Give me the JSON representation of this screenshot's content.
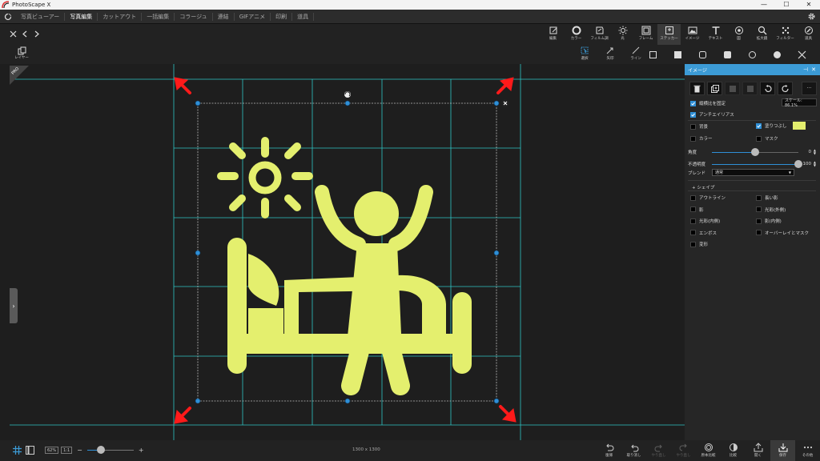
{
  "window": {
    "title": "PhotoScape X",
    "minimize": "—",
    "maximize": "☐",
    "close": "✕"
  },
  "menu": {
    "tabs": [
      "写真ビューアー",
      "写真編集",
      "カットアウト",
      "一括編集",
      "コラージュ",
      "連結",
      "GIFアニメ",
      "印刷",
      "道具"
    ],
    "active_index": 1
  },
  "toolbar": {
    "tools": [
      {
        "label": "編集",
        "icon": "edit-icon"
      },
      {
        "label": "カラー",
        "icon": "color-icon"
      },
      {
        "label": "フィルム調",
        "icon": "film-icon"
      },
      {
        "label": "光",
        "icon": "light-icon"
      },
      {
        "label": "フレーム",
        "icon": "frame-icon"
      },
      {
        "label": "ステッカー",
        "icon": "sticker-icon"
      },
      {
        "label": "イメージ",
        "icon": "image-icon"
      },
      {
        "label": "テキスト",
        "icon": "text-icon"
      },
      {
        "label": "図",
        "icon": "figure-icon"
      },
      {
        "label": "拡大鏡",
        "icon": "magnifier-icon"
      },
      {
        "label": "フィルター",
        "icon": "filter-icon"
      },
      {
        "label": "道具",
        "icon": "tools-icon"
      }
    ],
    "active_tool": "ステッカー"
  },
  "subbar": {
    "layer_label": "レイヤー",
    "select_label": "選択",
    "arrow_label": "矢印",
    "line_label": "ライン"
  },
  "canvas": {
    "badge": "PRO",
    "accent_color": "#e4ef6e",
    "guide_color": "#2ec4c4",
    "handle_color": "#2f8fd6",
    "arrow_color": "#ff1a1a"
  },
  "panel": {
    "title": "イメージ",
    "scale_label": "スケール: 86.1%",
    "keep_ratio": {
      "label": "縦横比を固定",
      "checked": true
    },
    "antialias": {
      "label": "アンチエイリアス",
      "checked": true
    },
    "background": {
      "label": "背景",
      "checked": false
    },
    "fill": {
      "label": "塗りつぶし",
      "checked": true,
      "color": "#e4ef6e"
    },
    "color": {
      "label": "カラー",
      "checked": false
    },
    "mask": {
      "label": "マスク",
      "checked": false
    },
    "angle": {
      "label": "角度",
      "value": "0",
      "fraction": 0.5
    },
    "opacity": {
      "label": "不透明度",
      "value": "100",
      "fraction": 1.0
    },
    "blend": {
      "label": "ブレンド",
      "value": "通常"
    },
    "shape_header": "シェイプ",
    "effects_left": [
      "アウトライン",
      "影",
      "光彩(内側)",
      "エンボス",
      "変形"
    ],
    "effects_right": [
      "長い影",
      "光彩(外側)",
      "影(内側)",
      "オーバーレイとマスク"
    ]
  },
  "status": {
    "zoom_percent": "62%",
    "zoom_fit": "1:1",
    "zoom_minus": "−",
    "zoom_plus": "+",
    "zoom_fraction": 0.3,
    "dimensions": "1300 x 1300"
  },
  "actions": [
    {
      "label": "復帰",
      "icon": "revert-icon",
      "enabled": true
    },
    {
      "label": "取り消し",
      "icon": "undo-icon",
      "enabled": true
    },
    {
      "label": "やり直し",
      "icon": "redo-icon",
      "enabled": false
    },
    {
      "label": "やり直し",
      "icon": "redo-all-icon",
      "enabled": false
    },
    {
      "label": "原本比較",
      "icon": "compare-original-icon",
      "enabled": true
    },
    {
      "label": "比較",
      "icon": "compare-icon",
      "enabled": true
    },
    {
      "label": "開く",
      "icon": "open-icon",
      "enabled": true
    },
    {
      "label": "保存",
      "icon": "save-icon",
      "enabled": true
    },
    {
      "label": "その他",
      "icon": "more-icon",
      "enabled": true
    }
  ]
}
